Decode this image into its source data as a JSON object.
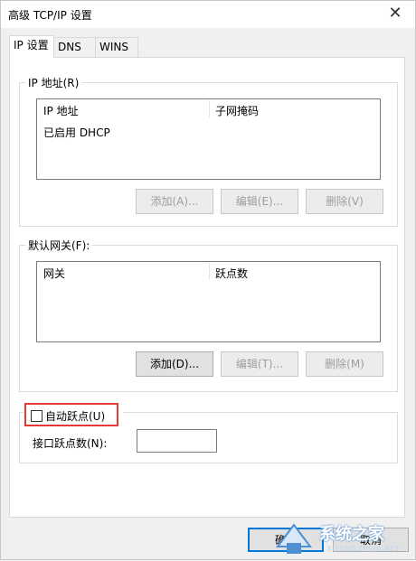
{
  "window": {
    "title": "高级 TCP/IP 设置",
    "close_glyph": "✕"
  },
  "tabs": [
    {
      "label": "IP 设置"
    },
    {
      "label": "DNS"
    },
    {
      "label": "WINS"
    }
  ],
  "ip_group": {
    "label": "IP 地址(R)",
    "columns": [
      "IP 地址",
      "子网掩码"
    ],
    "rows": [
      [
        "已启用 DHCP",
        ""
      ]
    ],
    "buttons": {
      "add": "添加(A)...",
      "edit": "编辑(E)...",
      "delete": "删除(V)"
    }
  },
  "gateway_group": {
    "label": "默认网关(F):",
    "columns": [
      "网关",
      "跃点数"
    ],
    "buttons": {
      "add": "添加(D)...",
      "edit": "编辑(T)...",
      "delete": "删除(M)"
    }
  },
  "metric": {
    "auto_label": "自动跃点(U)",
    "auto_checked": false,
    "interface_label": "接口跃点数(N):",
    "interface_value": ""
  },
  "footer": {
    "ok_label": "确定",
    "cancel_label": "取消"
  },
  "watermark": {
    "text": "系统之家",
    "sub": "XITONGZHIJIA.NET"
  },
  "colors": {
    "highlight_box": "#e53935",
    "default_button_border": "#0078d7"
  }
}
